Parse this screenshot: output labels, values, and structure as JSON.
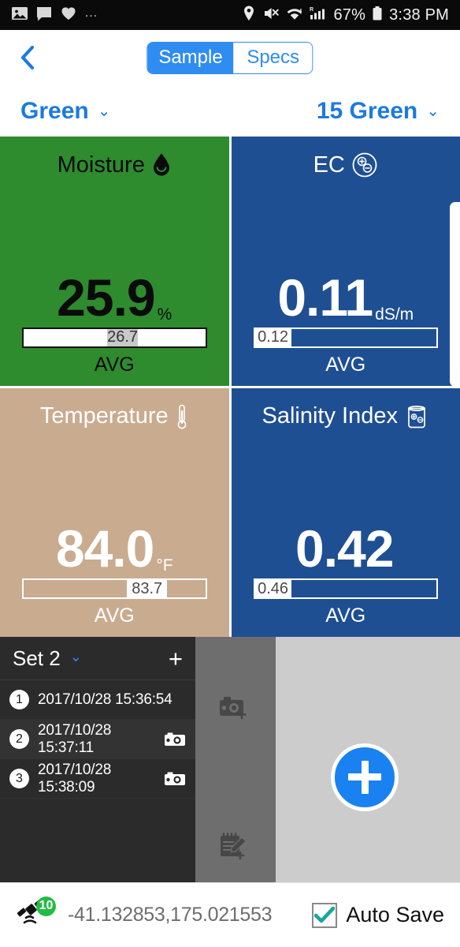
{
  "statusbar": {
    "left_icons": [
      "image-icon",
      "message-icon",
      "heart-icon"
    ],
    "overflow": "…",
    "right_icons": [
      "location-pin-icon",
      "volume-mute-icon",
      "wifi-alert-icon",
      "cell-signal-roaming-icon"
    ],
    "battery": "67%",
    "time": "3:38 PM"
  },
  "topnav": {
    "back_icon": "chevron-left-icon",
    "segments": [
      {
        "label": "Sample",
        "active": true
      },
      {
        "label": "Specs",
        "active": false
      }
    ]
  },
  "selectors": {
    "left": {
      "label": "Green",
      "chevron": "⌄"
    },
    "right": {
      "label": "15 Green",
      "chevron": "⌄"
    }
  },
  "tiles": [
    {
      "name": "moisture",
      "title": "Moisture",
      "icon": "water-drop-icon",
      "value": "25.9",
      "unit": "%",
      "avg_value": "26.7",
      "avg_label": "AVG",
      "bar_left_pct": 46,
      "bar_width_pct": 17,
      "bg": "#2e8b2e",
      "fg": "#0b0b0b"
    },
    {
      "name": "ec",
      "title": "EC",
      "icon": "ion-charge-icon",
      "value": "0.11",
      "unit": "dS/m",
      "avg_value": "0.12",
      "avg_label": "AVG",
      "bar_left_pct": 0,
      "bar_width_pct": 20,
      "bg": "#1e4f93",
      "fg": "#ffffff"
    },
    {
      "name": "temperature",
      "title": "Temperature",
      "icon": "thermometer-icon",
      "value": "84.0",
      "unit": "°F",
      "avg_value": "83.7",
      "avg_label": "AVG",
      "bar_left_pct": 57,
      "bar_width_pct": 22,
      "bg": "#c9ab90",
      "fg": "#ffffff"
    },
    {
      "name": "salinity-index",
      "title": "Salinity Index",
      "icon": "beaker-icon",
      "value": "0.42",
      "unit": "",
      "avg_value": "0.46",
      "avg_label": "AVG",
      "bar_left_pct": 0,
      "bar_width_pct": 20,
      "bg": "#1e4f93",
      "fg": "#ffffff"
    }
  ],
  "set_panel": {
    "title": "Set 2",
    "chevron": "⌄",
    "add_label": "+",
    "records": [
      {
        "num": "1",
        "timestamp": "2017/10/28 15:36:54",
        "has_photo": false
      },
      {
        "num": "2",
        "timestamp": "2017/10/28 15:37:11",
        "has_photo": true
      },
      {
        "num": "3",
        "timestamp": "2017/10/28 15:38:09",
        "has_photo": true
      }
    ]
  },
  "tools": {
    "add_photo_icon": "camera-add-icon",
    "add_note_icon": "note-add-icon"
  },
  "canvas": {
    "fab_icon": "plus-icon"
  },
  "bottombar": {
    "gps_icon": "satellite-icon",
    "satellite_count": "10",
    "coordinates": "-41.132853,175.021553",
    "autosave_label": "Auto Save",
    "autosave_checked": true,
    "check_color": "#17a898"
  },
  "colors": {
    "accent_blue": "#1c7ae0",
    "tile_green": "#2e8b2e",
    "tile_blue": "#1e4f93",
    "tile_tan": "#c9ab90",
    "panel_dark": "#2b2b2b",
    "panel_gray": "#6e6e6e",
    "canvas_gray": "#cccccc"
  }
}
